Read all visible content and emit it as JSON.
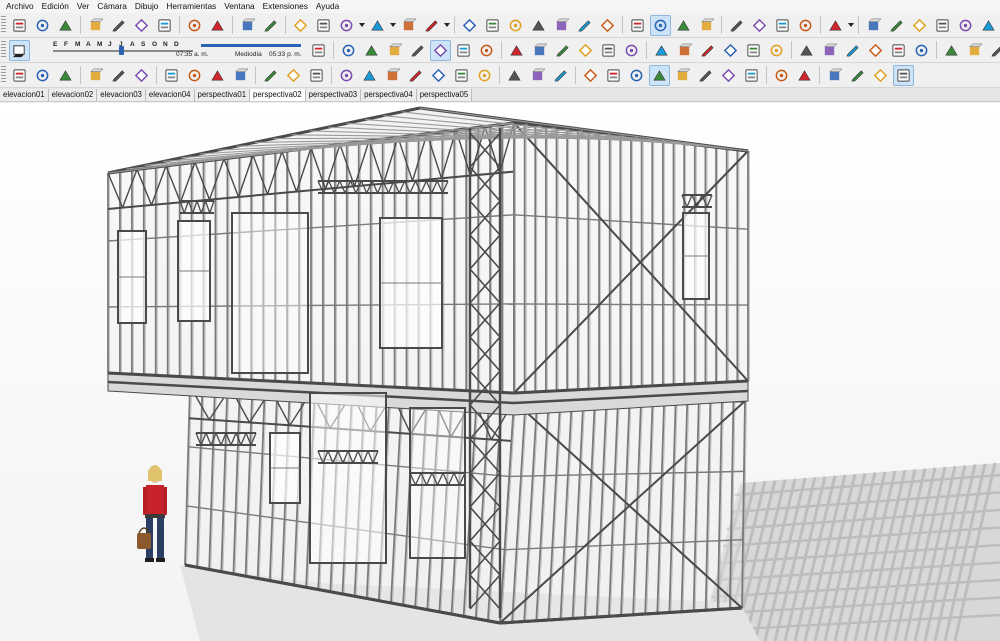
{
  "menu": [
    "Archivo",
    "Edición",
    "Ver",
    "Cámara",
    "Dibujo",
    "Herramientas",
    "Ventana",
    "Extensiones",
    "Ayuda"
  ],
  "shadows": {
    "months": [
      "E",
      "F",
      "M",
      "A",
      "M",
      "J",
      "J",
      "A",
      "S",
      "O",
      "N",
      "D"
    ],
    "time_start": "07:35 a. m.",
    "time_mid": "Mediodía",
    "time_end": "05:33 p. m."
  },
  "scenes": [
    "elevacion01",
    "elevacion02",
    "elevacion03",
    "elevacion04",
    "perspectiva01",
    "perspectiva02",
    "perspectiva03",
    "perspectiva04",
    "perspectiva05"
  ],
  "active_scene": "perspectiva02",
  "colors": {
    "frame": "#7a7a7a",
    "frame_dark": "#4a4a4a",
    "slab": "#d9d9d9",
    "shadow": "#bdbdbd",
    "accent_red": "#d0262d",
    "accent_blue": "#2a62b4"
  },
  "toolbar_icons": {
    "row1": [
      "new-icon",
      "open-icon",
      "save-icon",
      "cut-icon",
      "copy-icon",
      "paste-icon",
      "erase-icon",
      "undo-icon",
      "redo-icon",
      "print-icon",
      "model-info-icon",
      "select-icon",
      "eraser-icon",
      "pencil-icon",
      "arc-icon",
      "paint-bucket-icon",
      "push-pull-icon",
      "follow-me-icon",
      "move-icon",
      "scale-icon",
      "offset-icon",
      "tape-measure-icon",
      "text-icon",
      "protractor-icon",
      "orbit-icon",
      "pan-icon",
      "zoom-icon",
      "zoom-extents-icon",
      "warehouse-icon",
      "extension-warehouse-icon",
      "send-layout-icon",
      "ruby-icon",
      "account-icon",
      "outliner-icon",
      "entity-info-icon",
      "scenes-icon",
      "styles-icon",
      "edit-icon",
      "components-icon"
    ],
    "row2": [
      "shadows-toggle-icon",
      "xray-icon",
      "back-edges-icon",
      "wireframe-icon",
      "hidden-line-icon",
      "shaded-icon",
      "textured-icon",
      "monochrome-icon",
      "iso-view-icon",
      "top-view-icon",
      "front-view-icon",
      "right-view-icon",
      "back-view-icon",
      "left-view-icon",
      "validate-icon",
      "sandbox-icon",
      "cloud-icon",
      "terrain-icon",
      "stamp-icon",
      "drape-icon",
      "section-plane-icon",
      "section-cut-icon",
      "section-fill-icon",
      "axis-icon",
      "dimension-icon",
      "angle-icon",
      "walk-icon",
      "sun-icon",
      "tape-icon"
    ],
    "row3": [
      "tag-a-icon",
      "tag-b-icon",
      "tag-c-icon",
      "layer-green-icon",
      "layer-red-icon",
      "layer-blue-icon",
      "upload-a-icon",
      "upload-b-icon",
      "upload-c-icon",
      "upload-d-icon",
      "filter-a-icon",
      "filter-b-icon",
      "filter-c-icon",
      "stack-icon",
      "brush-a-icon",
      "brush-b-icon",
      "brush-c-icon",
      "brush-d-icon",
      "brush-e-icon",
      "brush-f-icon",
      "disk-icon",
      "tools-icon",
      "help-icon",
      "position-camera-icon",
      "look-around-icon",
      "walk-through-icon",
      "pan-view-icon",
      "zoom-view-icon",
      "zoom-window-icon",
      "zoom-ext-icon",
      "previous-icon",
      "eye-icon",
      "footprint-icon",
      "axes-icon",
      "cube-a-icon",
      "cube-b-icon",
      "cube-c-icon"
    ]
  }
}
